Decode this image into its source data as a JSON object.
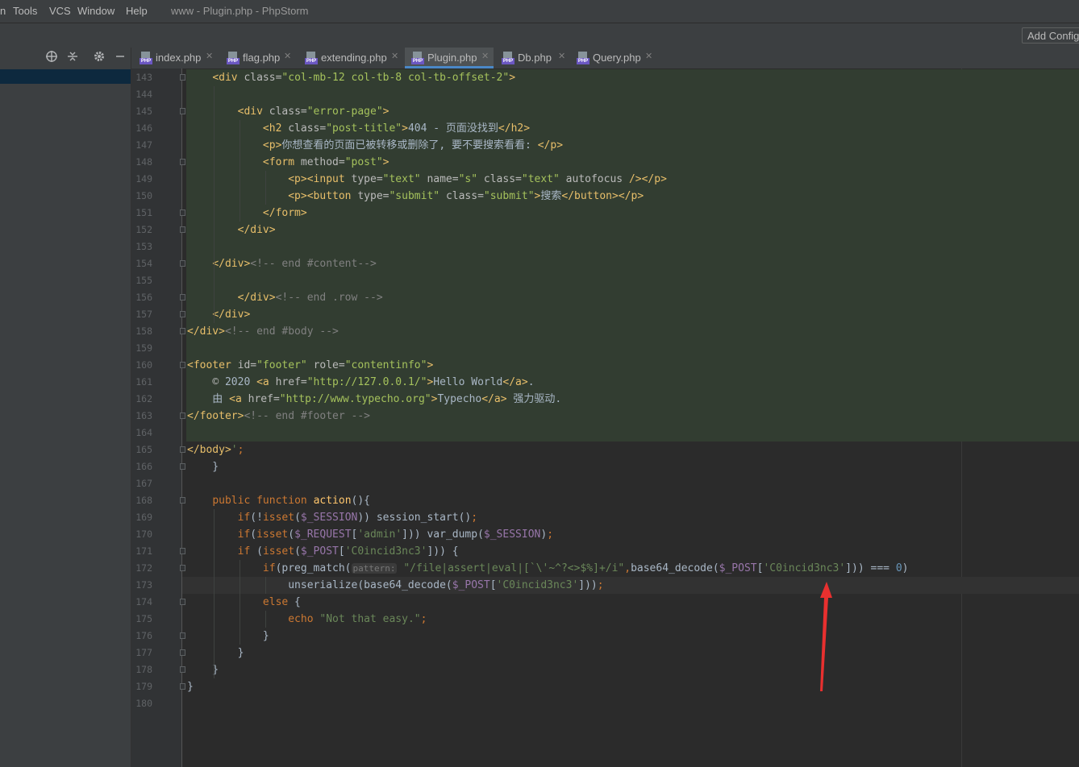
{
  "menubar": {
    "items": [
      "n",
      "Tools",
      "VCS",
      "Window",
      "Help"
    ],
    "title": "www - Plugin.php - PhpStorm"
  },
  "toolbar": {
    "add_config_label": "Add Config"
  },
  "tabs": [
    {
      "label": "index.php",
      "active": false
    },
    {
      "label": "flag.php",
      "active": false
    },
    {
      "label": "extending.php",
      "active": false
    },
    {
      "label": "Plugin.php",
      "active": true
    },
    {
      "label": "Db.php",
      "active": false
    },
    {
      "label": "Query.php",
      "active": false
    }
  ],
  "editor": {
    "current_line": 173,
    "param_hint": "pattern:",
    "lines": [
      {
        "n": 143,
        "text": "    <div class=\"col-mb-12 col-tb-8 col-tb-offset-2\">"
      },
      {
        "n": 144,
        "text": ""
      },
      {
        "n": 145,
        "text": "        <div class=\"error-page\">"
      },
      {
        "n": 146,
        "text": "            <h2 class=\"post-title\">404 - 页面没找到</h2>"
      },
      {
        "n": 147,
        "text": "            <p>你想查看的页面已被转移或删除了, 要不要搜索看看: </p>"
      },
      {
        "n": 148,
        "text": "            <form method=\"post\">"
      },
      {
        "n": 149,
        "text": "                <p><input type=\"text\" name=\"s\" class=\"text\" autofocus /></p>"
      },
      {
        "n": 150,
        "text": "                <p><button type=\"submit\" class=\"submit\">搜索</button></p>"
      },
      {
        "n": 151,
        "text": "            </form>"
      },
      {
        "n": 152,
        "text": "        </div>"
      },
      {
        "n": 153,
        "text": ""
      },
      {
        "n": 154,
        "text": "    </div><!-- end #content-->"
      },
      {
        "n": 155,
        "text": ""
      },
      {
        "n": 156,
        "text": "        </div><!-- end .row -->"
      },
      {
        "n": 157,
        "text": "    </div>"
      },
      {
        "n": 158,
        "text": "</div><!-- end #body -->"
      },
      {
        "n": 159,
        "text": ""
      },
      {
        "n": 160,
        "text": "<footer id=\"footer\" role=\"contentinfo\">"
      },
      {
        "n": 161,
        "text": "    &copy; 2020 <a href=\"http://127.0.0.1/\">Hello World</a>."
      },
      {
        "n": 162,
        "text": "    由 <a href=\"http://www.typecho.org\">Typecho</a> 强力驱动."
      },
      {
        "n": 163,
        "text": "</footer><!-- end #footer -->"
      },
      {
        "n": 164,
        "text": ""
      },
      {
        "n": 165,
        "text": "</body>';"
      },
      {
        "n": 166,
        "text": "    }"
      },
      {
        "n": 167,
        "text": ""
      },
      {
        "n": 168,
        "text": "    public function action(){"
      },
      {
        "n": 169,
        "text": "        if(!isset($_SESSION)) session_start();"
      },
      {
        "n": 170,
        "text": "        if(isset($_REQUEST['admin'])) var_dump($_SESSION);"
      },
      {
        "n": 171,
        "text": "        if (isset($_POST['C0incid3nc3'])) {"
      },
      {
        "n": 172,
        "text": "            if(preg_match(\"/file|assert|eval|[`\\'~^?<>$%]+/i\",base64_decode($_POST['C0incid3nc3'])) === 0)"
      },
      {
        "n": 173,
        "text": "                unserialize(base64_decode($_POST['C0incid3nc3']));"
      },
      {
        "n": 174,
        "text": "            else {"
      },
      {
        "n": 175,
        "text": "                echo \"Not that easy.\";"
      },
      {
        "n": 176,
        "text": "            }"
      },
      {
        "n": 177,
        "text": "        }"
      },
      {
        "n": 178,
        "text": "    }"
      },
      {
        "n": 179,
        "text": "}"
      },
      {
        "n": 180,
        "text": ""
      }
    ]
  },
  "colors": {
    "editor_bg": "#2b2b2b",
    "html_injection_bg": "#323d31",
    "current_line_bg": "#323232",
    "annotation_arrow": "#e8302f",
    "active_tab_underline": "#4a88c7"
  },
  "icons": [
    "target-icon",
    "collapse-icon",
    "gear-icon",
    "minimize-icon",
    "php-file-icon",
    "close-icon",
    "red-arrow-annotation"
  ]
}
